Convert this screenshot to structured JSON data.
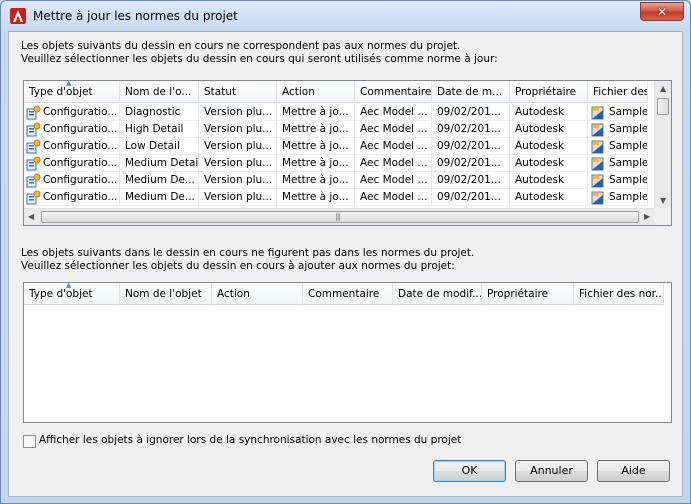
{
  "window": {
    "title": "Mettre à jour les normes du projet",
    "close_glyph": "✕"
  },
  "section1": {
    "line1": "Les objets suivants du dessin en cours ne correspondent pas aux normes du projet.",
    "line2": "Veuillez sélectionner les objets du dessin en cours qui seront utilisés comme norme à jour:",
    "headers": [
      "Type d'objet",
      "Nom de l'o...",
      "Statut",
      "Action",
      "Commentaire",
      "Date de m...",
      "Propriétaire",
      "Fichier des ..."
    ],
    "rows": [
      [
        "Configuratio...",
        "Diagnostic",
        "Version plu...",
        "Mettre à jo...",
        "Aec Model ...",
        "09/02/201...",
        "Autodesk",
        "Sample P"
      ],
      [
        "Configuratio...",
        "High Detail",
        "Version plu...",
        "Mettre à jo...",
        "Aec Model ...",
        "09/02/201...",
        "Autodesk",
        "Sample P"
      ],
      [
        "Configuratio...",
        "Low Detail",
        "Version plu...",
        "Mettre à jo...",
        "Aec Model ...",
        "09/02/201...",
        "Autodesk",
        "Sample P"
      ],
      [
        "Configuratio...",
        "Medium Detail",
        "Version plu...",
        "Mettre à jo...",
        "Aec Model ...",
        "09/02/201...",
        "Autodesk",
        "Sample P"
      ],
      [
        "Configuratio...",
        "Medium De...",
        "Version plu...",
        "Mettre à jo...",
        "Aec Model ...",
        "09/02/201...",
        "Autodesk",
        "Sample P"
      ],
      [
        "Configuratio...",
        "Medium De...",
        "Version plu...",
        "Mettre à jo...",
        "Aec Model ...",
        "09/02/201...",
        "Autodesk",
        "Sample P"
      ]
    ]
  },
  "section2": {
    "line1": "Les objets suivants dans le dessin en cours ne figurent pas dans les normes du projet.",
    "line2": "Veuillez sélectionner les objets du dessin en cours à ajouter aux normes du projet:",
    "headers": [
      "Type d'objet",
      "Nom de l'objet",
      "Action",
      "Commentaire",
      "Date de modif...",
      "Propriétaire",
      "Fichier des nor..."
    ]
  },
  "options": {
    "show_ignored_label": "Afficher les objets à ignorer lors de la synchronisation avec les normes du projet",
    "show_ignored_checked": false
  },
  "buttons": {
    "ok": "OK",
    "cancel": "Annuler",
    "help": "Aide"
  },
  "icons": {
    "app": "autocad-logo-icon",
    "config": "display-configuration-icon",
    "file": "standards-file-icon"
  }
}
